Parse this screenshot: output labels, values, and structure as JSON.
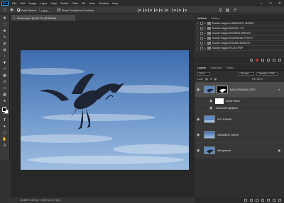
{
  "app": {
    "logo": "Ps"
  },
  "menu": [
    "File",
    "Edit",
    "Image",
    "Layer",
    "Type",
    "Select",
    "Filter",
    "3D",
    "View",
    "Window",
    "Help"
  ],
  "options_bar": {
    "auto_select_label": "Auto-Select:",
    "auto_select_value": "Layer",
    "transform_label": "Show Transform Controls"
  },
  "document": {
    "tab_title": "Raven.psd @ 66.7% (RGB/8#)",
    "status": "66.66%     1000 px x 1000 px (72 ppi)"
  },
  "actions_panel": {
    "tabs": [
      "Actions",
      "History"
    ],
    "items": [
      "Scarlet Images LUMINOSITY MASKS",
      "Scarlet Images BOOKS - CC",
      "Scarlet Images BROKEN MIRROR",
      "Scarlet Images ENGRAVED EFFECT",
      "Scarlet Images ENHANCEMENTS",
      "Scarlet Images FILM STRIP"
    ]
  },
  "layers_panel": {
    "tabs": [
      "Layers",
      "Channels",
      "Paths"
    ],
    "filter_label": "Kind",
    "blend_mode": "Normal",
    "opacity_label": "Opacity: 100%",
    "lock_label": "Lock:",
    "fill_label": "Fill: 100%",
    "layers": [
      {
        "name": "BACKGROUND COPY",
        "type": "bird-mask",
        "selected": true,
        "fx": true
      },
      {
        "name": "Smart Filters",
        "type": "smart-filters",
        "selected": false
      },
      {
        "name": "Shadows/Highlights",
        "type": "filter-entry",
        "selected": false
      },
      {
        "name": "SKY RANGE",
        "type": "sky",
        "selected": false
      },
      {
        "name": "GRADIENT LAYER",
        "type": "sky",
        "selected": false
      },
      {
        "name": "Background",
        "type": "bird",
        "selected": false,
        "locked": true
      }
    ]
  },
  "colors": {
    "accent": "#31a8ff",
    "sky_top": "#3d6cae",
    "sky_bottom": "#9dbde0"
  }
}
